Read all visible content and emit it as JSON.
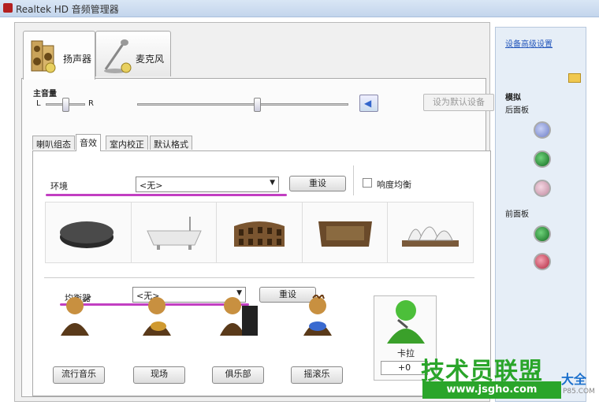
{
  "window": {
    "title": "Realtek HD 音频管理器"
  },
  "device_tabs": [
    {
      "label": "扬声器",
      "active": true
    },
    {
      "label": "麦克风",
      "active": false
    }
  ],
  "volume": {
    "title": "主音量",
    "left_label": "L",
    "right_label": "R",
    "balance": 0.5,
    "level": 0.57,
    "set_default_label": "设为默认设备"
  },
  "sub_tabs": [
    {
      "label": "喇叭组态",
      "active": false
    },
    {
      "label": "音效",
      "active": true
    },
    {
      "label": "室内校正",
      "active": false
    },
    {
      "label": "默认格式",
      "active": false
    }
  ],
  "environment": {
    "label": "环境",
    "selected": "<无>",
    "reset_label": "重设",
    "loudness_label": "响度均衡",
    "loudness_checked": false,
    "presets": [
      "stone-icon",
      "bathtub-icon",
      "colosseum-icon",
      "arena-icon",
      "opera-house-icon"
    ]
  },
  "equalizer": {
    "label": "均衡器",
    "selected": "<无>",
    "reset_label": "重设",
    "presets": [
      "流行音乐",
      "现场",
      "俱乐部",
      "摇滚乐"
    ]
  },
  "karaoke": {
    "label": "卡拉",
    "value": "+0"
  },
  "side_panel": {
    "advanced_link": "设备高级设置",
    "analog_label": "模拟",
    "rear_label": "后面板",
    "front_label": "前面板"
  },
  "watermark": {
    "big": "技术员联盟",
    "url": "www.jsgho.com",
    "side": "大全",
    "small": "P85.COM"
  },
  "colors": {
    "highlight": "#c23fc2",
    "jack_green": "#1a8a2a",
    "jack_blue": "#7d8ad0",
    "jack_pink": "#d6a8bb",
    "jack_red": "#c0304a"
  }
}
